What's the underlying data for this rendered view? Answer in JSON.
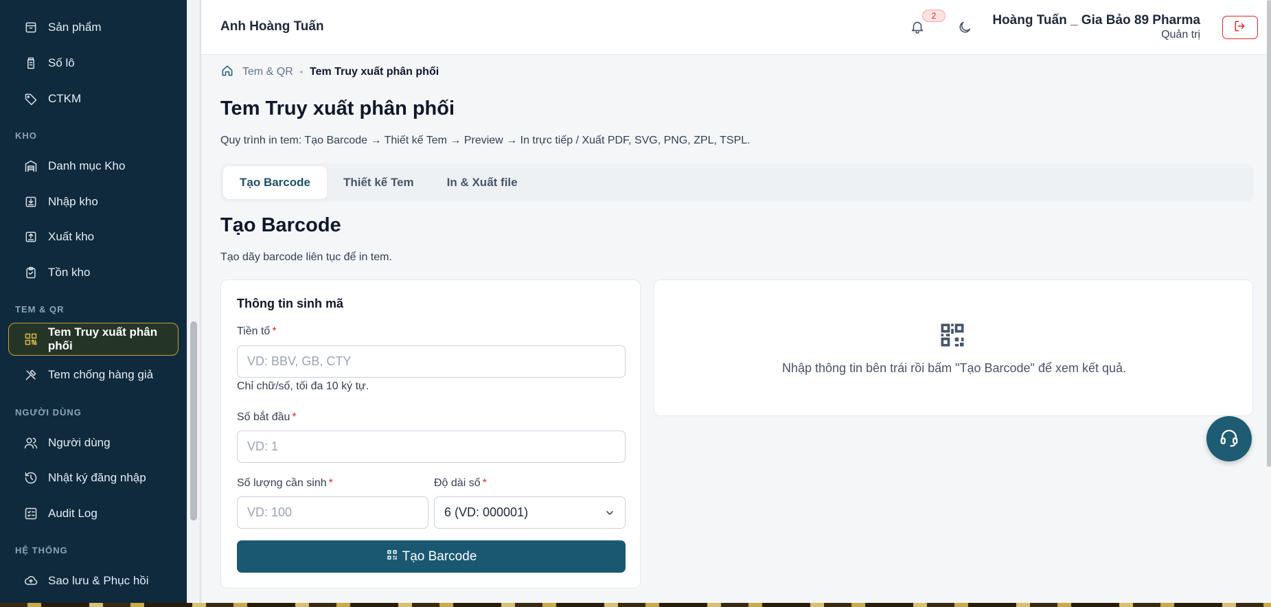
{
  "sidebar": {
    "items": [
      {
        "label": "Sản phẩm",
        "icon": "box-icon"
      },
      {
        "label": "Số lô",
        "icon": "bottle-icon"
      },
      {
        "label": "CTKM",
        "icon": "tag-icon"
      },
      {
        "label": "Danh mục Kho",
        "icon": "warehouse-icon"
      },
      {
        "label": "Nhập kho",
        "icon": "import-icon"
      },
      {
        "label": "Xuất kho",
        "icon": "export-icon"
      },
      {
        "label": "Tồn kho",
        "icon": "clipboard-icon"
      },
      {
        "label": "Tem Truy xuất phân phối",
        "icon": "qr-icon"
      },
      {
        "label": "Tem chống hàng giả",
        "icon": "tools-icon"
      },
      {
        "label": "Người dùng",
        "icon": "users-icon"
      },
      {
        "label": "Nhật ký đăng nhập",
        "icon": "history-icon"
      },
      {
        "label": "Audit Log",
        "icon": "checklist-icon"
      },
      {
        "label": "Sao lưu & Phục hồi",
        "icon": "cloud-icon"
      }
    ],
    "sections": {
      "kho": "KHO",
      "tem_qr": "TEM & QR",
      "nguoi_dung": "NGƯỜI DÙNG",
      "he_thong": "HỆ THỐNG"
    }
  },
  "topbar": {
    "user": "Anh Hoàng Tuấn",
    "notification_count": "2",
    "profile_name": "Hoàng Tuấn _ Gia Bảo 89 Pharma",
    "profile_role": "Quản trị"
  },
  "breadcrumb": {
    "parent": "Tem & QR",
    "current": "Tem Truy xuất phân phối"
  },
  "page": {
    "title": "Tem Truy xuất phân phối",
    "description": "Quy trình in tem: Tạo Barcode → Thiết kế Tem → Preview → In trực tiếp / Xuất PDF, SVG, PNG, ZPL, TSPL."
  },
  "tabs": [
    "Tạo Barcode",
    "Thiết kế Tem",
    "In & Xuất file"
  ],
  "section": {
    "title": "Tạo Barcode",
    "description": "Tạo dãy barcode liên tục để in tem."
  },
  "form": {
    "title": "Thông tin sinh mã",
    "prefix_label": "Tiền tố",
    "prefix_placeholder": "VD: BBV, GB, CTY",
    "prefix_hint": "Chỉ chữ/số, tối đa 10 ký tự.",
    "start_label": "Số bắt đầu",
    "start_placeholder": "VD: 1",
    "quantity_label": "Số lượng cần sinh",
    "quantity_placeholder": "VD: 100",
    "length_label": "Độ dài số",
    "length_value": "6 (VD: 000001)",
    "required_mark": "*",
    "submit_label": "Tạo Barcode"
  },
  "result": {
    "empty_message": "Nhập thông tin bên trái rồi bấm \"Tạo Barcode\" để xem kết quả."
  },
  "colors": {
    "sidebar_bg": "#0f2a3d",
    "accent": "#1a5872",
    "active_border": "#c9a13b",
    "danger": "#dc2626"
  }
}
